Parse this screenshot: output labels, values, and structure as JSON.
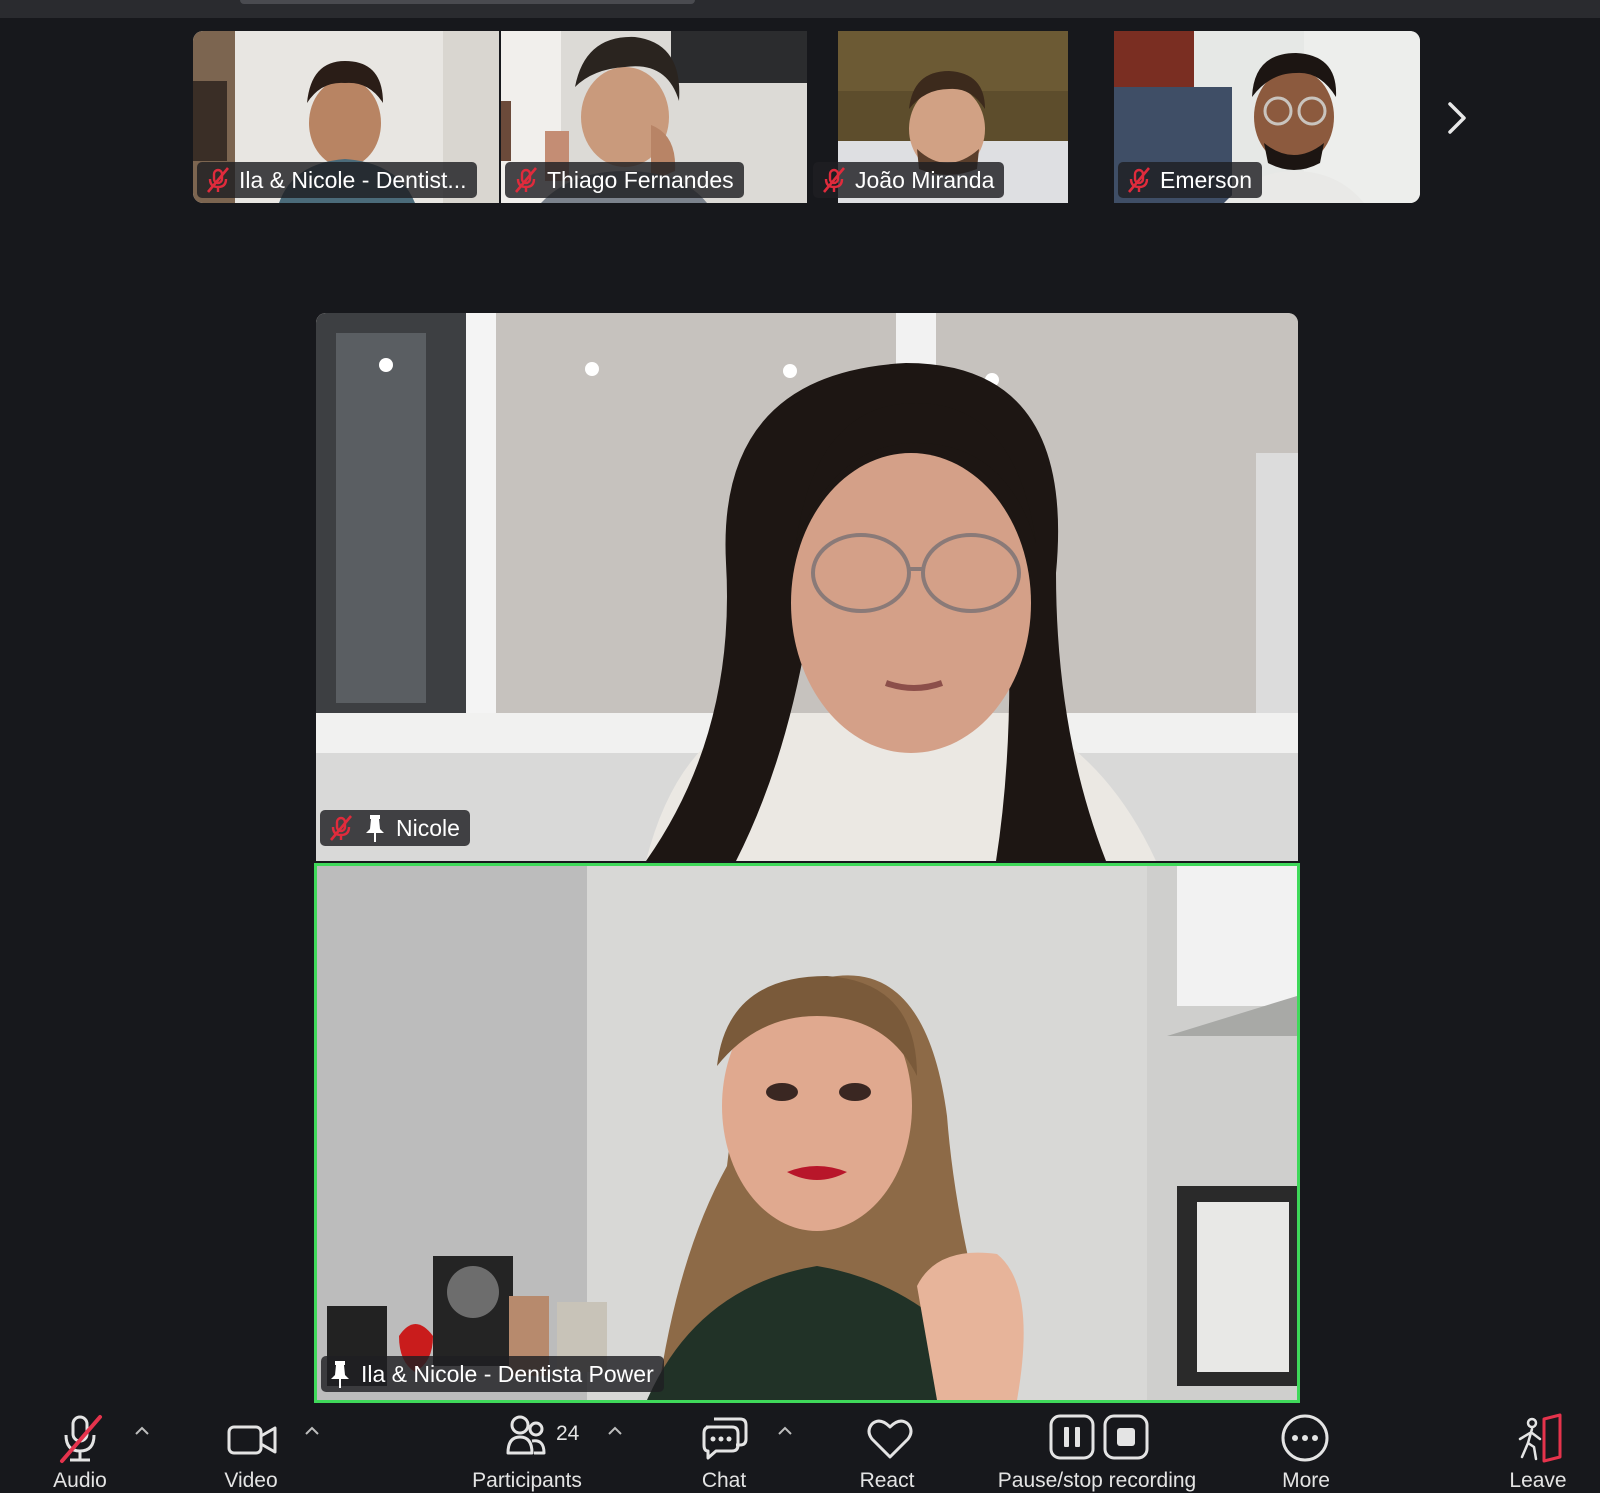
{
  "thumbnails": [
    {
      "name": "Ila & Nicole - Dentist...",
      "muted": true
    },
    {
      "name": "Thiago Fernandes",
      "muted": true
    },
    {
      "name": "João Miranda",
      "muted": true
    },
    {
      "name": "Emerson",
      "muted": true
    }
  ],
  "main_tiles": [
    {
      "name": "Nicole",
      "muted": true,
      "pinned": true,
      "active_speaker": false
    },
    {
      "name": "Ila & Nicole - Dentista Power",
      "muted": false,
      "pinned": true,
      "active_speaker": true
    }
  ],
  "toolbar": {
    "audio_label": "Audio",
    "video_label": "Video",
    "participants_label": "Participants",
    "participants_count": "24",
    "chat_label": "Chat",
    "react_label": "React",
    "recording_label": "Pause/stop recording",
    "more_label": "More",
    "leave_label": "Leave"
  },
  "colors": {
    "background": "#17181c",
    "active_speaker_border": "#3fd85a",
    "muted_red": "#e02b3c",
    "leave_red": "#e5334c"
  }
}
